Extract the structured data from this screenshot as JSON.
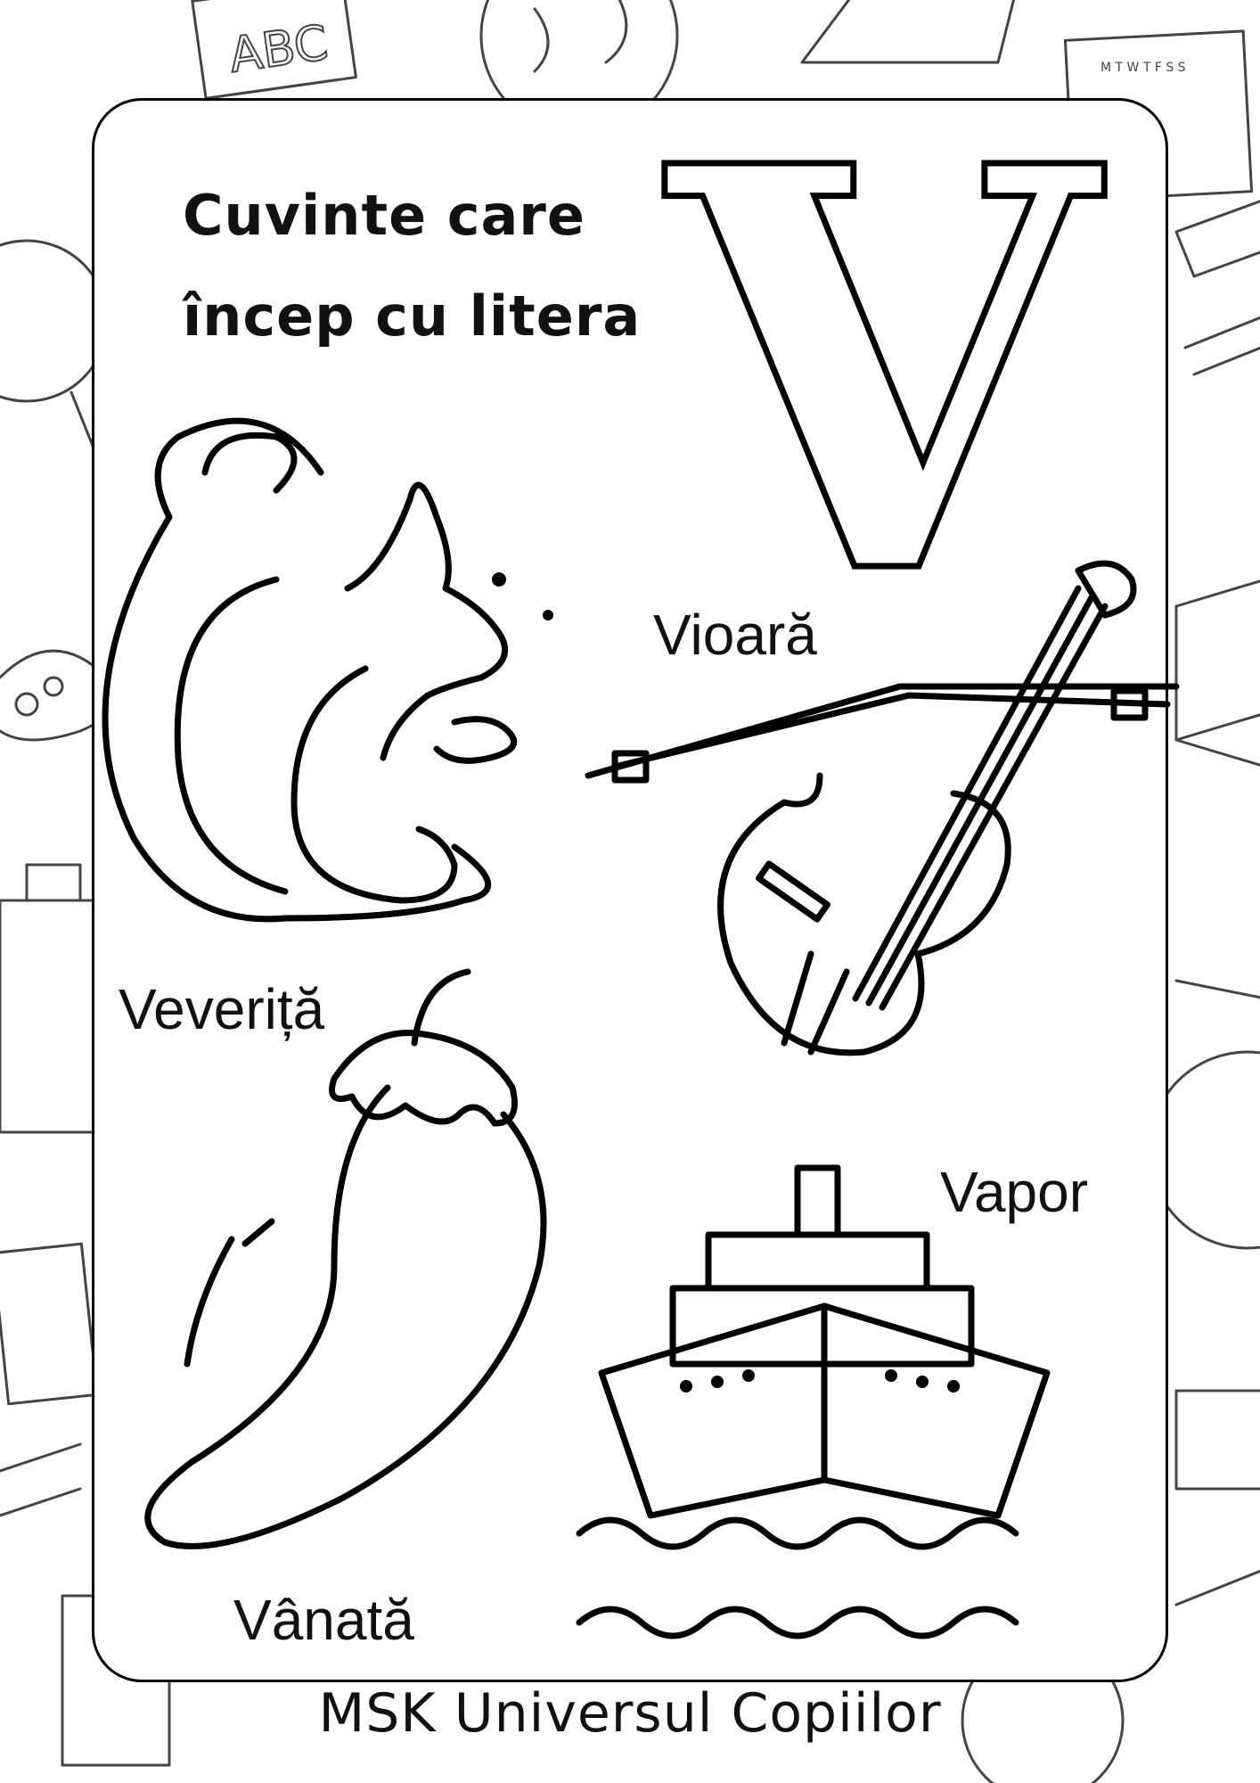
{
  "heading": {
    "line1": "Cuvinte care",
    "line2": "încep cu litera",
    "letter": "V"
  },
  "words": {
    "vioara": "Vioară",
    "veverita": "Veveriță",
    "vapor": "Vapor",
    "vanata": "Vânată"
  },
  "background_doodles": {
    "abc_board": "ABC",
    "calendar_days": "M T W T F S S"
  },
  "footer": "MSK Universul Copiilor",
  "colors": {
    "ink": "#000000",
    "paper": "#ffffff",
    "doodle": "#444444"
  }
}
